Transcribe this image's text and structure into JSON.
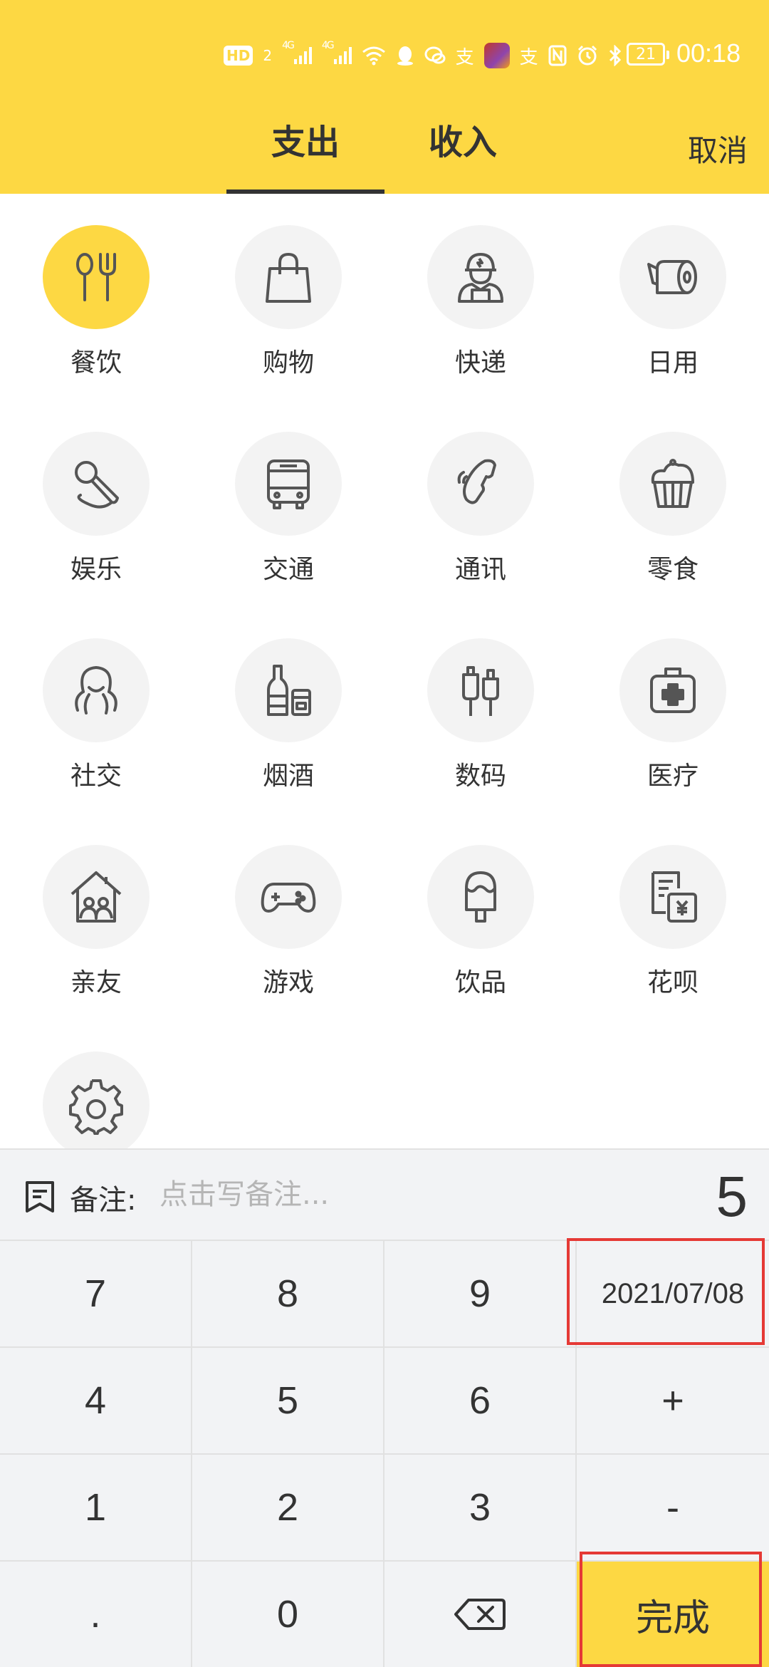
{
  "status_bar": {
    "time": "00:18",
    "battery": "21",
    "icons": [
      "hd-icon",
      "sim2-icon",
      "signal-4g-icon",
      "signal-4g-icon",
      "wifi-icon",
      "qq-icon",
      "chat-icon",
      "alipay-icon",
      "game-avatar-icon",
      "alipay-icon",
      "nfc-icon",
      "alarm-icon",
      "bluetooth-icon"
    ],
    "hd": "HD",
    "sim": "2",
    "net1": "4G",
    "net2": "4G"
  },
  "header": {
    "tabs": [
      {
        "label": "支出",
        "active": true
      },
      {
        "label": "收入",
        "active": false
      }
    ],
    "cancel": "取消"
  },
  "categories": [
    {
      "label": "餐饮",
      "icon": "fork-spoon-icon",
      "selected": true
    },
    {
      "label": "购物",
      "icon": "shopping-bag-icon"
    },
    {
      "label": "快递",
      "icon": "courier-icon"
    },
    {
      "label": "日用",
      "icon": "tissue-roll-icon"
    },
    {
      "label": "娱乐",
      "icon": "microphone-icon"
    },
    {
      "label": "交通",
      "icon": "bus-icon"
    },
    {
      "label": "通讯",
      "icon": "phone-icon"
    },
    {
      "label": "零食",
      "icon": "cupcake-icon"
    },
    {
      "label": "社交",
      "icon": "octopus-icon"
    },
    {
      "label": "烟酒",
      "icon": "bottle-icon"
    },
    {
      "label": "数码",
      "icon": "cable-plug-icon"
    },
    {
      "label": "医疗",
      "icon": "medical-kit-icon"
    },
    {
      "label": "亲友",
      "icon": "house-family-icon"
    },
    {
      "label": "游戏",
      "icon": "gamepad-icon"
    },
    {
      "label": "饮品",
      "icon": "popsicle-icon"
    },
    {
      "label": "花呗",
      "icon": "bill-yuan-icon"
    },
    {
      "label": "",
      "icon": "gear-icon"
    }
  ],
  "note": {
    "label": "备注:",
    "placeholder": "点击写备注..."
  },
  "amount": "5",
  "keypad": {
    "rows": [
      [
        "7",
        "8",
        "9",
        "2021/07/08"
      ],
      [
        "4",
        "5",
        "6",
        "+"
      ],
      [
        "1",
        "2",
        "3",
        "-"
      ],
      [
        ".",
        "0",
        "",
        "完成"
      ]
    ]
  },
  "colors": {
    "accent": "#FDD843",
    "highlight_box": "#E53935",
    "icon_stroke": "#555555",
    "circle_bg": "#F3F3F3"
  }
}
